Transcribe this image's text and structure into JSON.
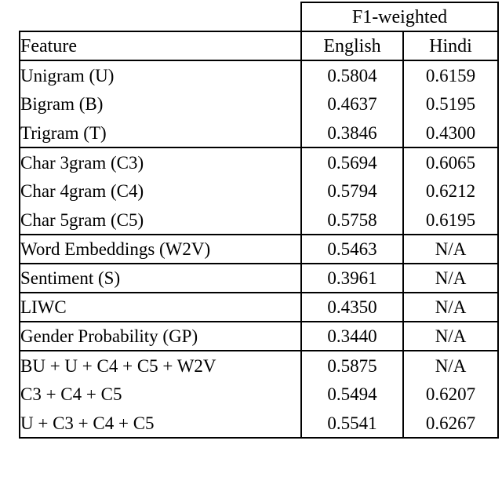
{
  "table": {
    "group_header": "F1-weighted",
    "columns": [
      {
        "key": "feature",
        "label": "Feature",
        "align": "left"
      },
      {
        "key": "english",
        "label": "English",
        "align": "center"
      },
      {
        "key": "hindi",
        "label": "Hindi",
        "align": "center"
      }
    ],
    "groups": [
      {
        "name": "ngram-word",
        "rows": [
          {
            "feature": "Unigram (U)",
            "english": "0.5804",
            "hindi": "0.6159",
            "english_bold": false,
            "hindi_bold": false
          },
          {
            "feature": "Bigram (B)",
            "english": "0.4637",
            "hindi": "0.5195",
            "english_bold": false,
            "hindi_bold": false
          },
          {
            "feature": "Trigram (T)",
            "english": "0.3846",
            "hindi": "0.4300",
            "english_bold": false,
            "hindi_bold": false
          }
        ]
      },
      {
        "name": "ngram-char",
        "rows": [
          {
            "feature": "Char 3gram (C3)",
            "english": "0.5694",
            "hindi": "0.6065",
            "english_bold": false,
            "hindi_bold": false
          },
          {
            "feature": "Char 4gram (C4)",
            "english": "0.5794",
            "hindi": "0.6212",
            "english_bold": false,
            "hindi_bold": false
          },
          {
            "feature": "Char 5gram (C5)",
            "english": "0.5758",
            "hindi": "0.6195",
            "english_bold": false,
            "hindi_bold": false
          }
        ]
      },
      {
        "name": "word-embeddings",
        "rows": [
          {
            "feature": "Word Embeddings (W2V)",
            "english": "0.5463",
            "hindi": "N/A",
            "english_bold": false,
            "hindi_bold": false
          }
        ]
      },
      {
        "name": "sentiment",
        "rows": [
          {
            "feature": "Sentiment (S)",
            "english": "0.3961",
            "hindi": "N/A",
            "english_bold": false,
            "hindi_bold": false
          }
        ]
      },
      {
        "name": "liwc",
        "rows": [
          {
            "feature": "LIWC",
            "english": "0.4350",
            "hindi": "N/A",
            "english_bold": false,
            "hindi_bold": false
          }
        ]
      },
      {
        "name": "gender-probability",
        "rows": [
          {
            "feature": "Gender Probability (GP)",
            "english": "0.3440",
            "hindi": "N/A",
            "english_bold": false,
            "hindi_bold": false
          }
        ]
      },
      {
        "name": "combinations",
        "rows": [
          {
            "feature": "BU + U + C4 + C5 + W2V",
            "english": "0.5875",
            "hindi": "N/A",
            "english_bold": true,
            "hindi_bold": false
          },
          {
            "feature": "C3 + C4 + C5",
            "english": "0.5494",
            "hindi": "0.6207",
            "english_bold": false,
            "hindi_bold": false
          },
          {
            "feature": "U + C3 + C4 + C5",
            "english": "0.5541",
            "hindi": "0.6267",
            "english_bold": false,
            "hindi_bold": true
          }
        ]
      }
    ]
  }
}
